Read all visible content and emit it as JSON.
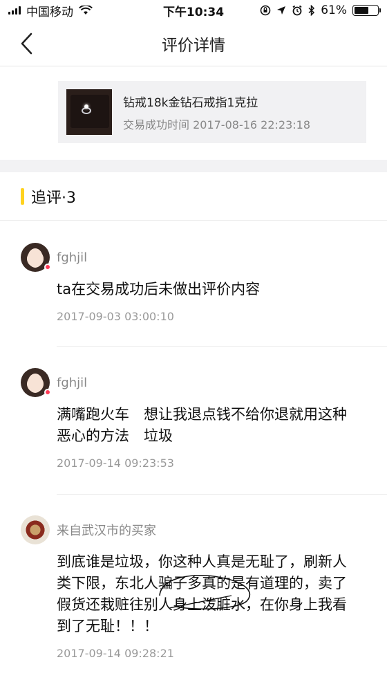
{
  "status_bar": {
    "carrier": "中国移动",
    "time": "下午10:34",
    "battery_percent": "61%",
    "battery_level": 0.61
  },
  "navbar": {
    "title": "评价详情",
    "back_icon": "chevron-left-icon"
  },
  "product": {
    "name": "钻戒18k金钻石戒指1克拉",
    "trade_time": "交易成功时间 2017-08-16 22:23:18"
  },
  "section": {
    "title": "追评·3",
    "accent_color": "#ffd21f"
  },
  "comments": [
    {
      "user": "fghjil",
      "body": "ta在交易成功后未做出评价内容",
      "time": "2017-09-03 03:00:10"
    },
    {
      "user": "fghjil",
      "body": "满嘴跑火车　想让我退点钱不给你退就用这种恶心的方法　垃圾",
      "time": "2017-09-14 09:23:53"
    },
    {
      "user": "来自武汉市的买家",
      "body": "到底谁是垃圾，你这种人真是无耻了，刷新人类下限，东北人骗子多真的是有道理的，卖了假货还栽赃往别人身上泼脏水，在你身上我看到了无耻！！！",
      "time": "2017-09-14 09:28:21"
    }
  ]
}
